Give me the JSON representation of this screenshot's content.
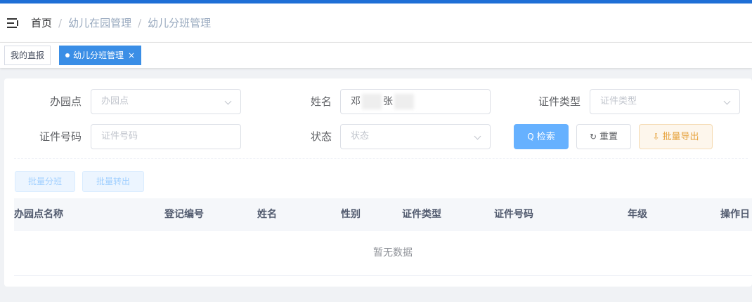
{
  "breadcrumb": {
    "home": "首页",
    "separator": "/",
    "level1": "幼儿在园管理",
    "level2": "幼儿分班管理"
  },
  "tags": {
    "inactive": "我的直报",
    "active": "幼儿分班管理",
    "close": "×"
  },
  "form": {
    "campus_label": "办园点",
    "campus_placeholder": "办园点",
    "name_label": "姓名",
    "name_part1": "邓",
    "name_part2": "张",
    "idtype_label": "证件类型",
    "idtype_placeholder": "证件类型",
    "idno_label": "证件号码",
    "idno_placeholder": "证件号码",
    "status_label": "状态",
    "status_placeholder": "状态"
  },
  "buttons": {
    "search_icon": "Q",
    "search": "检索",
    "reset_icon": "↻",
    "reset": "重置",
    "export_icon": "⇩",
    "export": "批量导出",
    "batch_assign": "批量分班",
    "batch_transfer": "批量转出"
  },
  "table": {
    "columns": [
      "办园点名称",
      "登记编号",
      "姓名",
      "性别",
      "证件类型",
      "证件号码",
      "年级",
      "操作日"
    ],
    "empty_text": "暂无数据"
  },
  "colors": {
    "accent": "#1f6fd6",
    "primary_button": "#66b1ff",
    "warning_text": "#e6a23c"
  }
}
